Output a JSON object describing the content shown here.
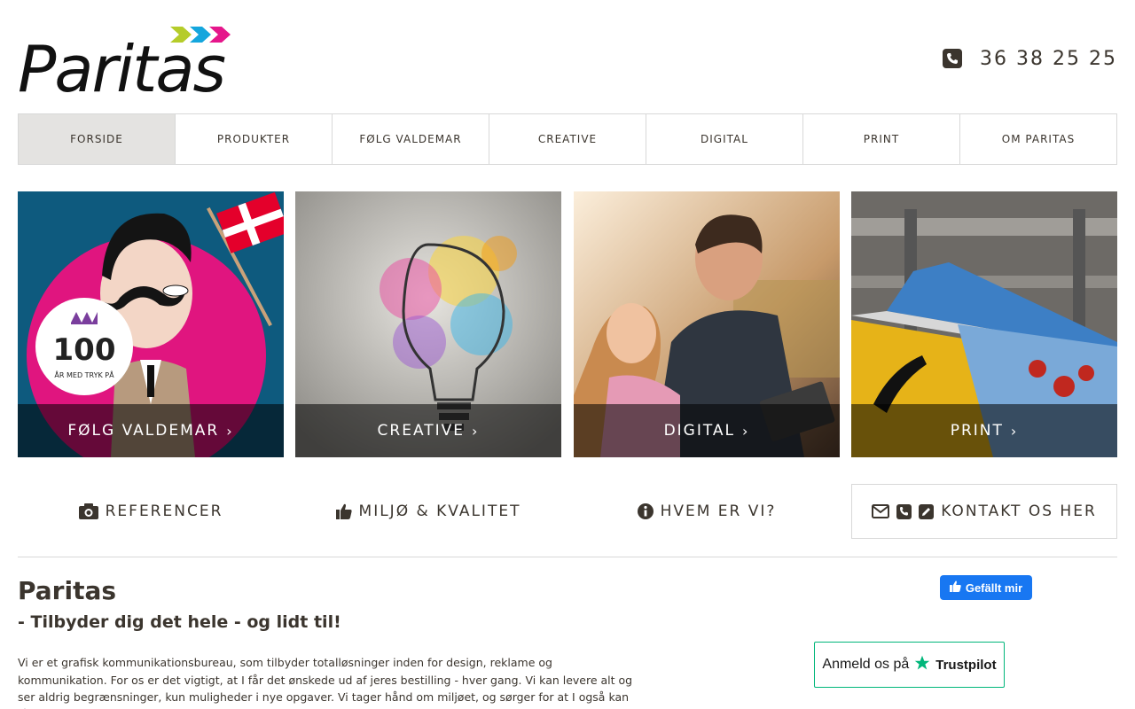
{
  "brand": {
    "logo_text": "Paritas",
    "arrow_colors": [
      "#b5cc2a",
      "#14a6dd",
      "#e5168b"
    ]
  },
  "header": {
    "phone_number": "36 38 25 25"
  },
  "nav": {
    "items": [
      {
        "label": "FORSIDE",
        "active": true
      },
      {
        "label": "PRODUKTER",
        "active": false
      },
      {
        "label": "FØLG VALDEMAR",
        "active": false
      },
      {
        "label": "CREATIVE",
        "active": false
      },
      {
        "label": "DIGITAL",
        "active": false
      },
      {
        "label": "PRINT",
        "active": false
      },
      {
        "label": "OM PARITAS",
        "active": false
      }
    ]
  },
  "tiles": [
    {
      "label": "FØLG VALDEMAR",
      "badge_number": "100",
      "badge_text": "ÅR MED TRYK PÅ"
    },
    {
      "label": "CREATIVE"
    },
    {
      "label": "DIGITAL"
    },
    {
      "label": "PRINT"
    }
  ],
  "quick_links": [
    {
      "label": "REFERENCER",
      "icon": "camera-icon"
    },
    {
      "label": "MILJØ & KVALITET",
      "icon": "thumbs-up-icon"
    },
    {
      "label": "HVEM ER VI?",
      "icon": "info-icon"
    },
    {
      "label": "KONTAKT OS HER",
      "icons": [
        "envelope-icon",
        "phone-icon",
        "pencil-icon"
      ]
    }
  ],
  "main": {
    "title": "Paritas",
    "subtitle": "- Tilbyder dig det hele - og lidt til!",
    "body": "Vi er et grafisk kommunikationsbureau, som tilbyder totalløsninger inden for design, reklame og kommunikation. For os er det vigtigt, at I får det ønskede ud af jeres bestilling - hver gang. Vi kan levere alt og ser aldrig begrænsninger, kun muligheder i nye opgaver. Vi tager hånd om miljøet, og sørger for at I også kan få et grønt ansigt udadtil. Derudover har vi"
  },
  "social": {
    "facebook_like_label": "Gefällt mir",
    "trustpilot_label": "Anmeld os på",
    "trustpilot_brand": "Trustpilot",
    "trustpilot_color": "#00b67a",
    "facebook_color": "#1877f2"
  }
}
